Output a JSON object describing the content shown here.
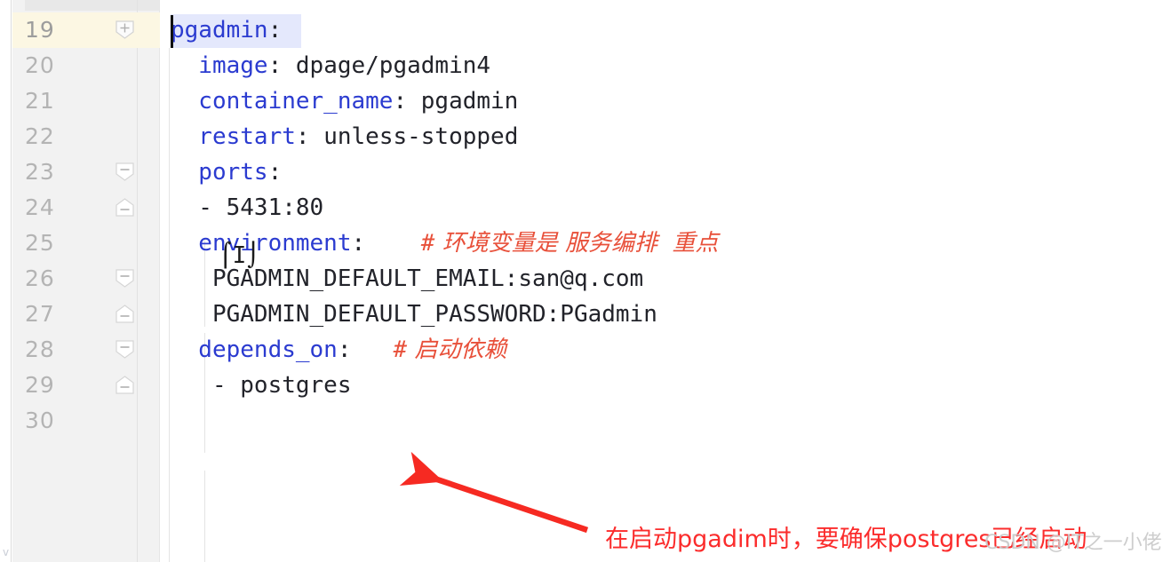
{
  "editor": {
    "name": "yaml-code-editor",
    "language": "yaml",
    "gutter_bg": "#f2f2f2",
    "code_bg": "#ffffff",
    "key_color": "#2b3bd0",
    "value_color": "#22232a",
    "comment_color": "#e8503a",
    "current_line_color": "#fcf7e3",
    "selection_color": "#dfe4fb",
    "annotation_color": "#fb2c2c",
    "left_strip_glyph": "v"
  },
  "lines": [
    {
      "number": "19",
      "fold": "collapse-plus",
      "current": true,
      "indent": 0,
      "segments": [
        {
          "kind": "key",
          "text": "pgadmin"
        },
        {
          "kind": "plain",
          "text": ":"
        }
      ]
    },
    {
      "number": "20",
      "fold": "none",
      "current": false,
      "indent": 1,
      "segments": [
        {
          "kind": "key",
          "text": "  image"
        },
        {
          "kind": "plain",
          "text": ": "
        },
        {
          "kind": "value",
          "text": "dpage/pgadmin4"
        }
      ]
    },
    {
      "number": "21",
      "fold": "none",
      "current": false,
      "indent": 1,
      "segments": [
        {
          "kind": "key",
          "text": "  container_name"
        },
        {
          "kind": "plain",
          "text": ": "
        },
        {
          "kind": "value",
          "text": "pgadmin"
        }
      ]
    },
    {
      "number": "22",
      "fold": "none",
      "current": false,
      "indent": 1,
      "segments": [
        {
          "kind": "key",
          "text": "  restart"
        },
        {
          "kind": "plain",
          "text": ": "
        },
        {
          "kind": "value",
          "text": "unless-stopped"
        }
      ]
    },
    {
      "number": "23",
      "fold": "collapse-top",
      "current": false,
      "indent": 1,
      "segments": [
        {
          "kind": "key",
          "text": "  ports"
        },
        {
          "kind": "plain",
          "text": ":"
        }
      ]
    },
    {
      "number": "24",
      "fold": "collapse-bottom",
      "current": false,
      "indent": 1,
      "segments": [
        {
          "kind": "value",
          "text": "  - 5431:80"
        }
      ]
    },
    {
      "number": "25",
      "fold": "none",
      "current": false,
      "indent": 1,
      "segments": [
        {
          "kind": "key",
          "text": "  environment"
        },
        {
          "kind": "plain",
          "text": ":"
        },
        {
          "kind": "comment-hash",
          "text": "    #"
        },
        {
          "kind": "comment",
          "text": " 环境变量是 服务编排  重点"
        }
      ]
    },
    {
      "number": "26",
      "fold": "collapse-top",
      "current": false,
      "indent": 2,
      "segments": [
        {
          "kind": "value",
          "text": "   PGADMIN_DEFAULT_EMAIL:san@q.com"
        }
      ]
    },
    {
      "number": "27",
      "fold": "collapse-bottom",
      "current": false,
      "indent": 2,
      "segments": [
        {
          "kind": "value",
          "text": "   PGADMIN_DEFAULT_PASSWORD:PGadmin"
        }
      ]
    },
    {
      "number": "28",
      "fold": "collapse-top",
      "current": false,
      "indent": 1,
      "segments": [
        {
          "kind": "key",
          "text": "  depends_on"
        },
        {
          "kind": "plain",
          "text": ":"
        },
        {
          "kind": "comment-hash",
          "text": "   #"
        },
        {
          "kind": "comment",
          "text": " 启动依赖"
        }
      ]
    },
    {
      "number": "29",
      "fold": "collapse-bottom",
      "current": false,
      "indent": 2,
      "segments": [
        {
          "kind": "value",
          "text": "   - postgres"
        }
      ]
    },
    {
      "number": "30",
      "fold": "none",
      "current": false,
      "indent": 0,
      "segments": []
    }
  ],
  "annotations": {
    "arrow_label": "red-arrow-pointing-to-depends-on",
    "note_text": "在启动pgadim时，要确保postgres已经启动",
    "watermark_text": "CSDN @IT之一小佬"
  }
}
